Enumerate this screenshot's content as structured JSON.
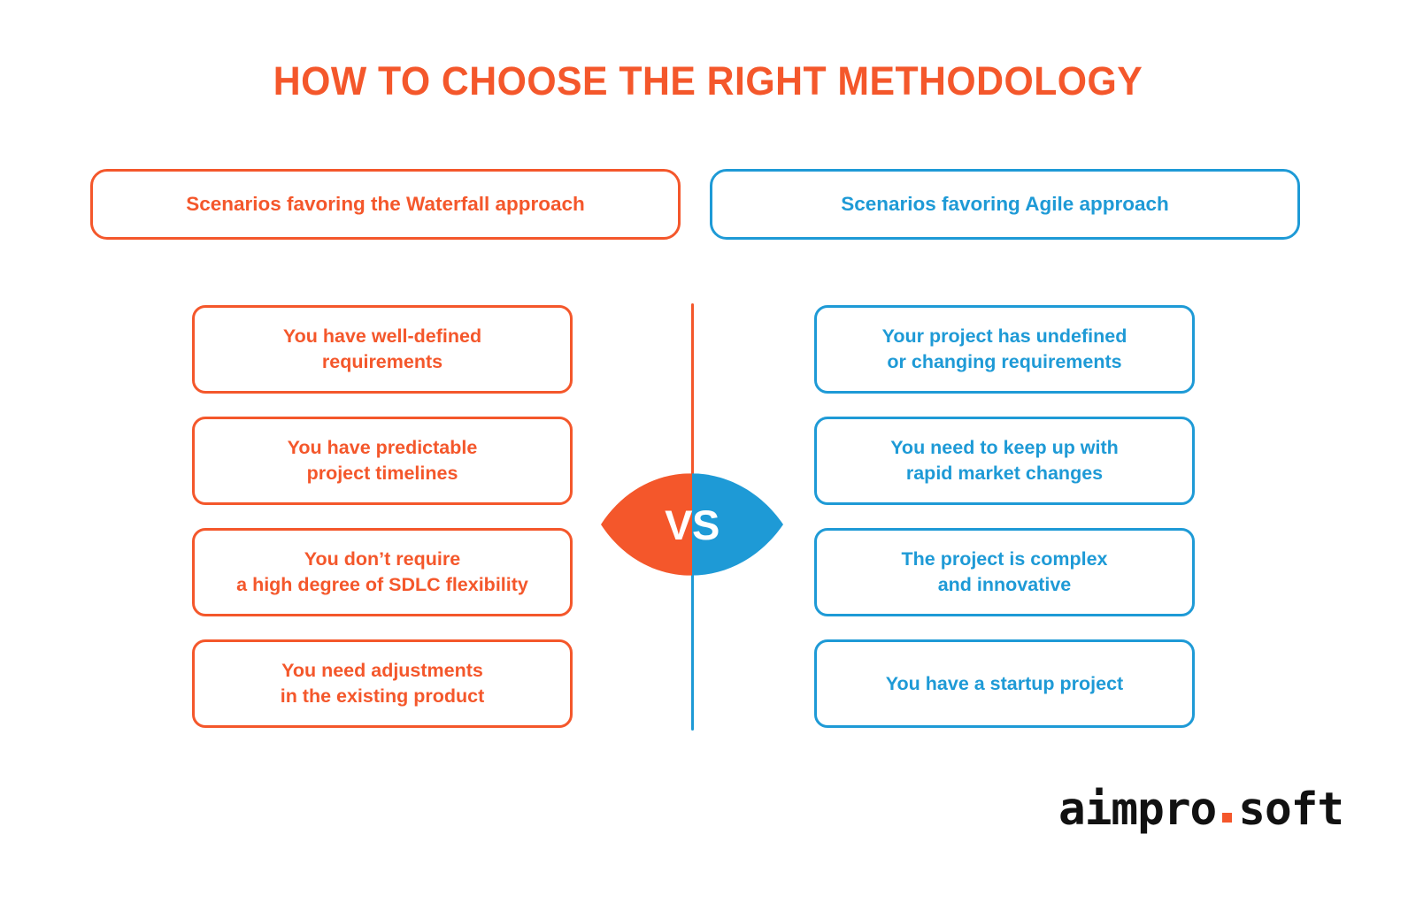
{
  "title": "HOW TO CHOOSE THE RIGHT METHODOLOGY",
  "colors": {
    "orange": "#F4572B",
    "blue": "#1E9AD6",
    "white": "#FFFFFF",
    "logo_text": "#111111"
  },
  "columns": {
    "left": {
      "header": "Scenarios favoring the Waterfall approach",
      "accent": "#F4572B",
      "cards": [
        "You have well-defined\nrequirements",
        "You have predictable\nproject timelines",
        "You don’t require\na high degree of SDLC flexibility",
        "You need adjustments\nin the existing product"
      ]
    },
    "right": {
      "header": "Scenarios favoring Agile approach",
      "accent": "#1E9AD6",
      "cards": [
        "Your project has undefined\nor changing requirements",
        "You need to keep up with\nrapid market changes",
        "The project is complex\nand innovative",
        "You have a startup project"
      ]
    }
  },
  "vs_badge": {
    "label": "VS",
    "left_color": "#F4572B",
    "right_color": "#1E9AD6",
    "shape": "lens-eye-shape"
  },
  "divider": {
    "top_color": "#F4572B",
    "bottom_color": "#1E9AD6"
  },
  "logo": {
    "first": "aimpro",
    "separator": "dot",
    "second": "soft",
    "dot_color": "#F4572B"
  }
}
